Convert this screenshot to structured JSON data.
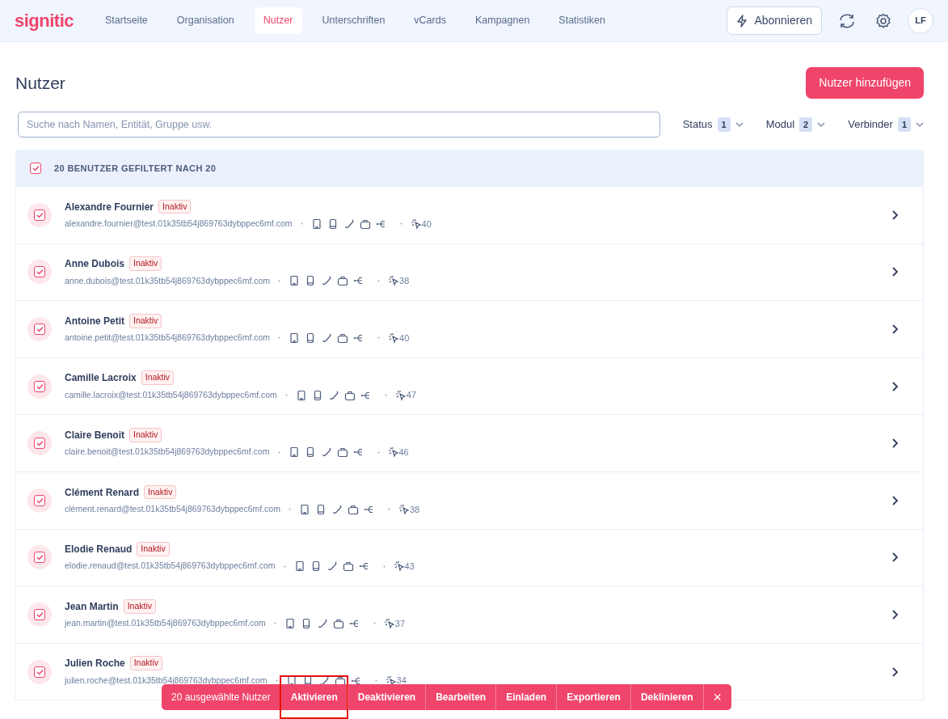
{
  "brand": "signitic",
  "nav": [
    {
      "label": "Startseite",
      "selected": false
    },
    {
      "label": "Organisation",
      "selected": false
    },
    {
      "label": "Nutzer",
      "selected": true
    },
    {
      "label": "Unterschriften",
      "selected": false
    },
    {
      "label": "vCards",
      "selected": false
    },
    {
      "label": "Kampagnen",
      "selected": false
    },
    {
      "label": "Statistiken",
      "selected": false
    }
  ],
  "subscribe_button": "Abonnieren",
  "avatar": "LF",
  "title": "Nutzer",
  "add_button": "Nutzer hinzufügen",
  "search": {
    "placeholder": "Suche nach Namen, Entität, Gruppe usw."
  },
  "filters": [
    {
      "label": "Status",
      "count": "1"
    },
    {
      "label": "Modul",
      "count": "2"
    },
    {
      "label": "Verbinder",
      "count": "1"
    }
  ],
  "list_header": {
    "label": "20 BENUTZER GEFILTERT NACH 20",
    "checked": true
  },
  "users": [
    {
      "name": "Alexandre Fournier",
      "status": "Inaktiv",
      "email": "alexandre.fournier@test.01k35tb54j869763dybppec6mf.com",
      "clicks": "40",
      "checked": true
    },
    {
      "name": "Anne Dubois",
      "status": "Inaktiv",
      "email": "anne.dubois@test.01k35tb54j869763dybppec6mf.com",
      "clicks": "38",
      "checked": true
    },
    {
      "name": "Antoine Petit",
      "status": "Inaktiv",
      "email": "antoine.petit@test.01k35tb54j869763dybppec6mf.com",
      "clicks": "40",
      "checked": true
    },
    {
      "name": "Camille Lacroix",
      "status": "Inaktiv",
      "email": "camille.lacroix@test.01k35tb54j869763dybppec6mf.com",
      "clicks": "47",
      "checked": true
    },
    {
      "name": "Claire Benoit",
      "status": "Inaktiv",
      "email": "claire.benoit@test.01k35tb54j869763dybppec6mf.com",
      "clicks": "46",
      "checked": true
    },
    {
      "name": "Clément Renard",
      "status": "Inaktiv",
      "email": "clément.renard@test.01k35tb54j869763dybppec6mf.com",
      "clicks": "38",
      "checked": true
    },
    {
      "name": "Elodie Renaud",
      "status": "Inaktiv",
      "email": "elodie.renaud@test.01k35tb54j869763dybppec6mf.com",
      "clicks": "43",
      "checked": true
    },
    {
      "name": "Jean Martin",
      "status": "Inaktiv",
      "email": "jean.martin@test.01k35tb54j869763dybppec6mf.com",
      "clicks": "37",
      "checked": true
    },
    {
      "name": "Julien Roche",
      "status": "Inaktiv",
      "email": "julien.roche@test.01k35tb54j869763dybppec6mf.com",
      "clicks": "34",
      "checked": true
    }
  ],
  "action_bar": {
    "count_label": "20 ausgewählte Nutzer",
    "actions": [
      {
        "label": "Aktivieren",
        "highlighted": true
      },
      {
        "label": "Deaktivieren",
        "highlighted": false
      },
      {
        "label": "Bearbeiten",
        "highlighted": false
      },
      {
        "label": "Einladen",
        "highlighted": false
      },
      {
        "label": "Exportieren",
        "highlighted": false
      },
      {
        "label": "Deklinieren",
        "highlighted": false
      }
    ],
    "close": "×"
  }
}
